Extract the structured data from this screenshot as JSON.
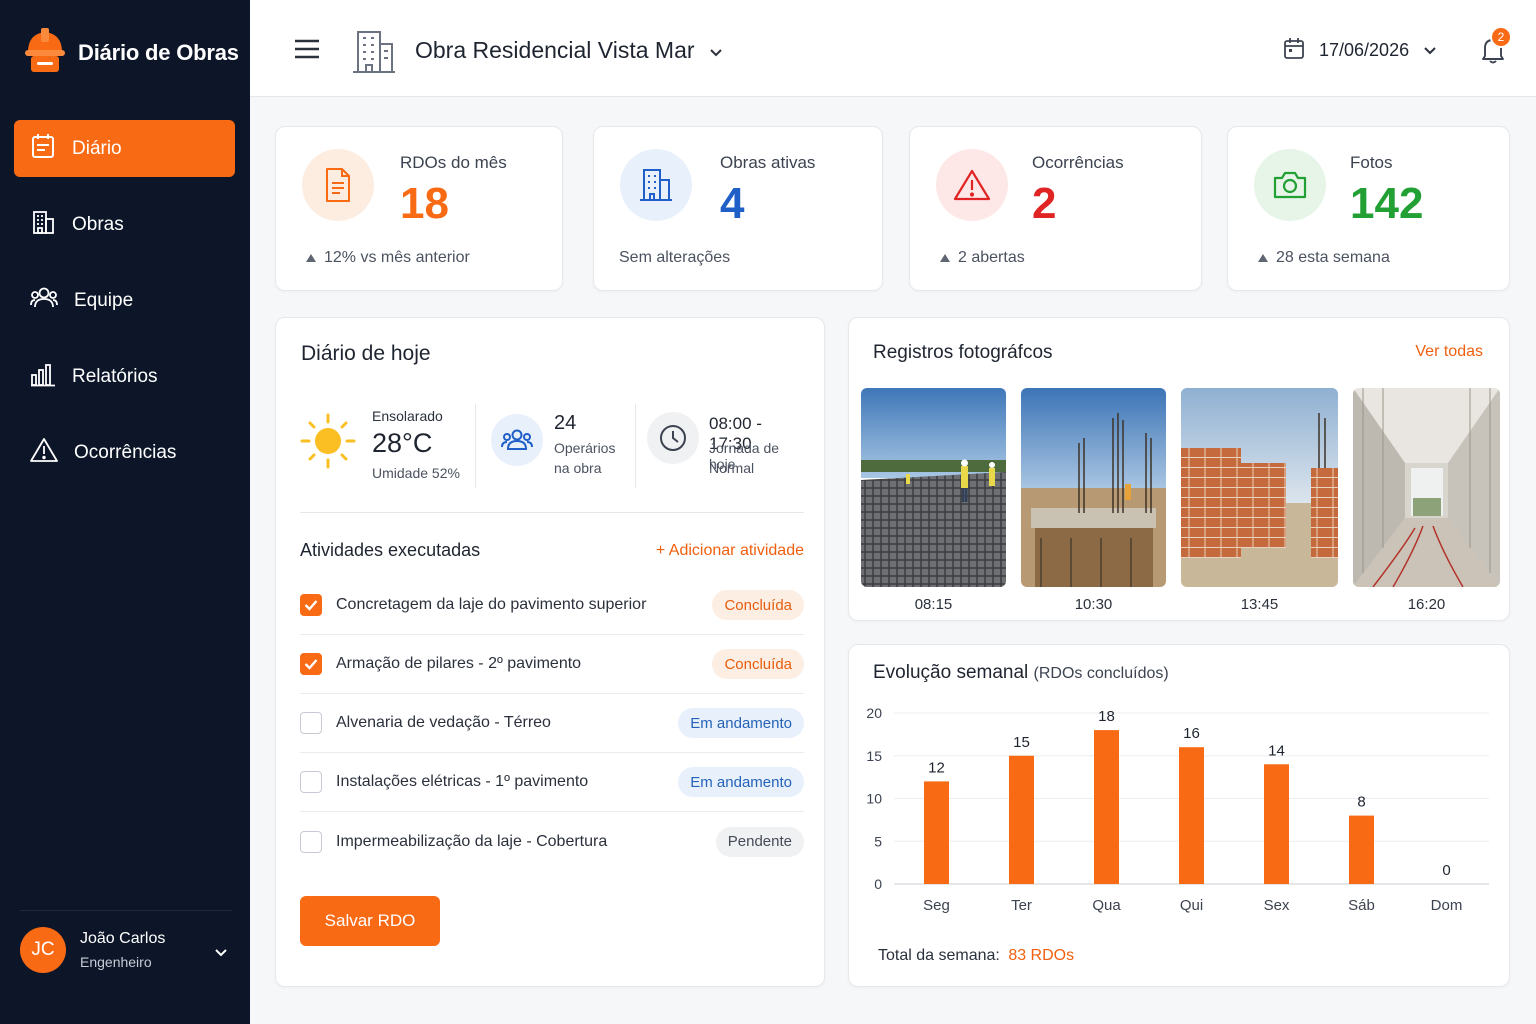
{
  "app": {
    "name": "Diário de Obras"
  },
  "sidebar": {
    "items": [
      {
        "label": "Diário",
        "icon": "calendar-doc-icon",
        "active": true
      },
      {
        "label": "Obras",
        "icon": "building-icon"
      },
      {
        "label": "Equipe",
        "icon": "team-icon"
      },
      {
        "label": "Relatórios",
        "icon": "bar-chart-icon"
      },
      {
        "label": "Ocorrências",
        "icon": "warning-icon"
      }
    ],
    "user": {
      "initials": "JC",
      "name": "João Carlos",
      "role": "Engenheiro"
    }
  },
  "header": {
    "project": "Obra Residencial Vista Mar",
    "date": "17/06/2026",
    "notifications": "2"
  },
  "stats": [
    {
      "label": "RDOs do mês",
      "value": "18",
      "foot": "12% vs mês anterior",
      "color": "#f96a15",
      "icon": "document-icon"
    },
    {
      "label": "Obras ativas",
      "value": "4",
      "foot": "Sem alterações",
      "color": "#1f5fc7",
      "icon": "building-icon"
    },
    {
      "label": "Ocorrências",
      "value": "2",
      "foot": "2 abertas",
      "color": "#e02424",
      "icon": "warning-icon"
    },
    {
      "label": "Fotos",
      "value": "142",
      "foot": "28 esta semana",
      "color": "#22a034",
      "icon": "camera-icon"
    }
  ],
  "today": {
    "title": "Diário de hoje",
    "weather": {
      "condition": "Ensolarado",
      "temp": "28°C",
      "humidity": "Umidade 52%"
    },
    "workers": {
      "count": "24",
      "line1": "Operários",
      "line2": "na obra"
    },
    "shift": {
      "hours": "08:00 - 17:30",
      "line1": "Jornada de hoje",
      "line2": "Normal"
    },
    "activities_title": "Atividades executadas",
    "add_activity": "+ Adicionar atividade",
    "activities": [
      {
        "text": "Concretagem da laje do pavimento superior",
        "status": "Concluída",
        "checked": true
      },
      {
        "text": "Armação de pilares - 2º pavimento",
        "status": "Concluída",
        "checked": true
      },
      {
        "text": "Alvenaria de vedação - Térreo",
        "status": "Em andamento",
        "checked": false
      },
      {
        "text": "Instalações elétricas - 1º pavimento",
        "status": "Em andamento",
        "checked": false
      },
      {
        "text": "Impermeabilização da laje - Cobertura",
        "status": "Pendente",
        "checked": false
      }
    ],
    "save_button": "Salvar RDO"
  },
  "photos": {
    "title": "Registros fotográfcos",
    "see_all": "Ver todas",
    "items": [
      {
        "time": "08:15"
      },
      {
        "time": "10:30"
      },
      {
        "time": "13:45"
      },
      {
        "time": "16:20"
      }
    ]
  },
  "weekly": {
    "title": "Evolução semanal",
    "subtitle": "(RDOs concluídos)",
    "total_label": "Total da semana:",
    "total_value": "83 RDOs"
  },
  "chart_data": {
    "type": "bar",
    "categories": [
      "Seg",
      "Ter",
      "Qua",
      "Qui",
      "Sex",
      "Sáb",
      "Dom"
    ],
    "values": [
      12,
      15,
      18,
      16,
      14,
      8,
      0
    ],
    "yticks": [
      0,
      5,
      10,
      15,
      20
    ],
    "ylim": [
      0,
      20
    ],
    "color": "#f96a15",
    "grid": true
  }
}
